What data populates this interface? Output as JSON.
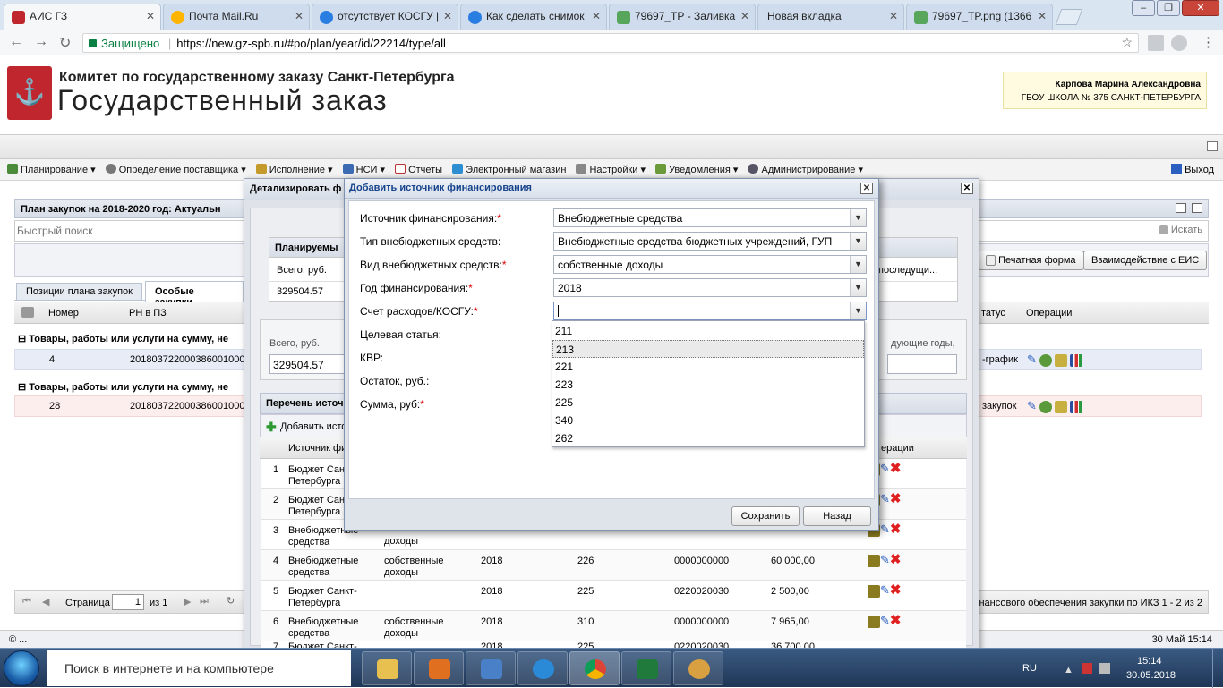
{
  "browser": {
    "tabs": [
      {
        "label": "АИС ГЗ",
        "active": true
      },
      {
        "label": "Почта Mail.Ru"
      },
      {
        "label": "отсутствует КОСГУ |"
      },
      {
        "label": "Как сделать снимок"
      },
      {
        "label": "79697_ТР - Заливка"
      },
      {
        "label": "Новая вкладка"
      },
      {
        "label": "79697_TP.png (1366"
      }
    ],
    "secure_label": "Защищено",
    "url": "https://new.gz-spb.ru/#po/plan/year/id/22214/type/all"
  },
  "header": {
    "org": "Комитет по государственному заказу Санкт-Петербурга",
    "brand": "Государственный заказ",
    "user_name": "Карпова Марина Александровна",
    "user_org": "ГБОУ ШКОЛА № 375 САНКТ-ПЕТЕРБУРГА"
  },
  "menu": {
    "items": [
      "Планирование",
      "Определение поставщика",
      "Исполнение",
      "НСИ",
      "Отчеты",
      "Электронный магазин",
      "Настройки",
      "Уведомления",
      "Администрирование"
    ],
    "logout": "Выход"
  },
  "plan": {
    "title": "План закупок на 2018-2020 год: Актуальн",
    "quick_search_placeholder": "Быстрый поиск",
    "search_btn": "Искать",
    "print_btn": "Печатная форма",
    "eis_btn": "Взаимодействие с ЕИС",
    "tabs": [
      "Позиции плана закупок",
      "Особые закупки"
    ],
    "columns": {
      "num": "Номер",
      "rn": "РН в ПЗ",
      "status": "татус",
      "ops": "Операции"
    },
    "group1": "Товары, работы или услуги на сумму, не",
    "row1": {
      "num": "4",
      "rn": "2018037220003860010000",
      "status": "-график"
    },
    "group2": "Товары, работы или услуги на сумму, не",
    "row2": {
      "num": "28",
      "rn": "2018037220003860010000",
      "status": "закупок"
    },
    "pager_label": "Страница",
    "pager_value": "1",
    "pager_of": "из 1",
    "footer_info": "нансового обеспечения закупки по ИКЗ 1 - 2 из 2"
  },
  "detail": {
    "title": "Детализировать ф",
    "planned_header": "Планируемы",
    "total_label": "Всего, руб.",
    "total_value": "329504.57",
    "next_label": "последущи...",
    "total2_label": "Всего, руб.",
    "total2_value": "329504.57",
    "next2_label": "дующие годы,",
    "list_header": "Перечень источ",
    "add_link": "Добавить исто",
    "col_source": "Источник фи",
    "col_ops": "ерации",
    "rows": [
      {
        "n": "1",
        "source": "Бюджет Сан Петербурга",
        "type": "",
        "year": "",
        "kosgu": "",
        "kvr": "",
        "sum": ""
      },
      {
        "n": "2",
        "source": "Бюджет Сан Петербурга",
        "type": "",
        "year": "",
        "kosgu": "",
        "kvr": "",
        "sum": ""
      },
      {
        "n": "3",
        "source": "Внебюджетные средства",
        "type": "доходы",
        "year": "",
        "kosgu": "",
        "kvr": "",
        "sum": ""
      },
      {
        "n": "4",
        "source": "Внебюджетные средства",
        "type": "собственные доходы",
        "year": "2018",
        "kosgu": "226",
        "kvr": "0000000000",
        "sum": "60 000,00"
      },
      {
        "n": "5",
        "source": "Бюджет Санкт-Петербурга",
        "type": "",
        "year": "2018",
        "kosgu": "225",
        "kvr": "0220020030",
        "sum": "2 500,00"
      },
      {
        "n": "6",
        "source": "Внебюджетные средства",
        "type": "собственные доходы",
        "year": "2018",
        "kosgu": "310",
        "kvr": "0000000000",
        "sum": "7 965,00"
      },
      {
        "n": "7",
        "source": "Бюджет Санкт-",
        "type": "",
        "year": "2018",
        "kosgu": "225",
        "kvr": "0220020030",
        "sum": "36 700,00"
      }
    ]
  },
  "dialog": {
    "title": "Добавить источник финансирования",
    "fields": {
      "source_label": "Источник финансирования:",
      "source_value": "Внебюджетные средства",
      "type_label": "Тип внебюджетных средств:",
      "type_value": "Внебюджетные средства бюджетных учреждений, ГУП",
      "kind_label": "Вид внебюджетных средств:",
      "kind_value": "собственные доходы",
      "year_label": "Год финансирования:",
      "year_value": "2018",
      "kosgu_label": "Счет расходов/КОСГУ:",
      "kosgu_value": "",
      "target_label": "Целевая статья:",
      "kvr_label": "КВР:",
      "rest_label": "Остаток, руб.:",
      "sum_label": "Сумма, руб:"
    },
    "dropdown_options": [
      "211",
      "213",
      "221",
      "223",
      "225",
      "340",
      "262"
    ],
    "highlighted_option": "213",
    "save_btn": "Сохранить",
    "back_btn": "Назад"
  },
  "status": {
    "left": "© ...",
    "datetime": "30 Май 15:14"
  },
  "taskbar": {
    "search_placeholder": "Поиск в интернете и на компьютере",
    "lang": "RU",
    "time": "15:14",
    "date": "30.05.2018"
  },
  "colors": {
    "accent": "#15428b",
    "brand_red": "#c0262d",
    "required": "#dd0000",
    "secure": "#0b8043"
  }
}
